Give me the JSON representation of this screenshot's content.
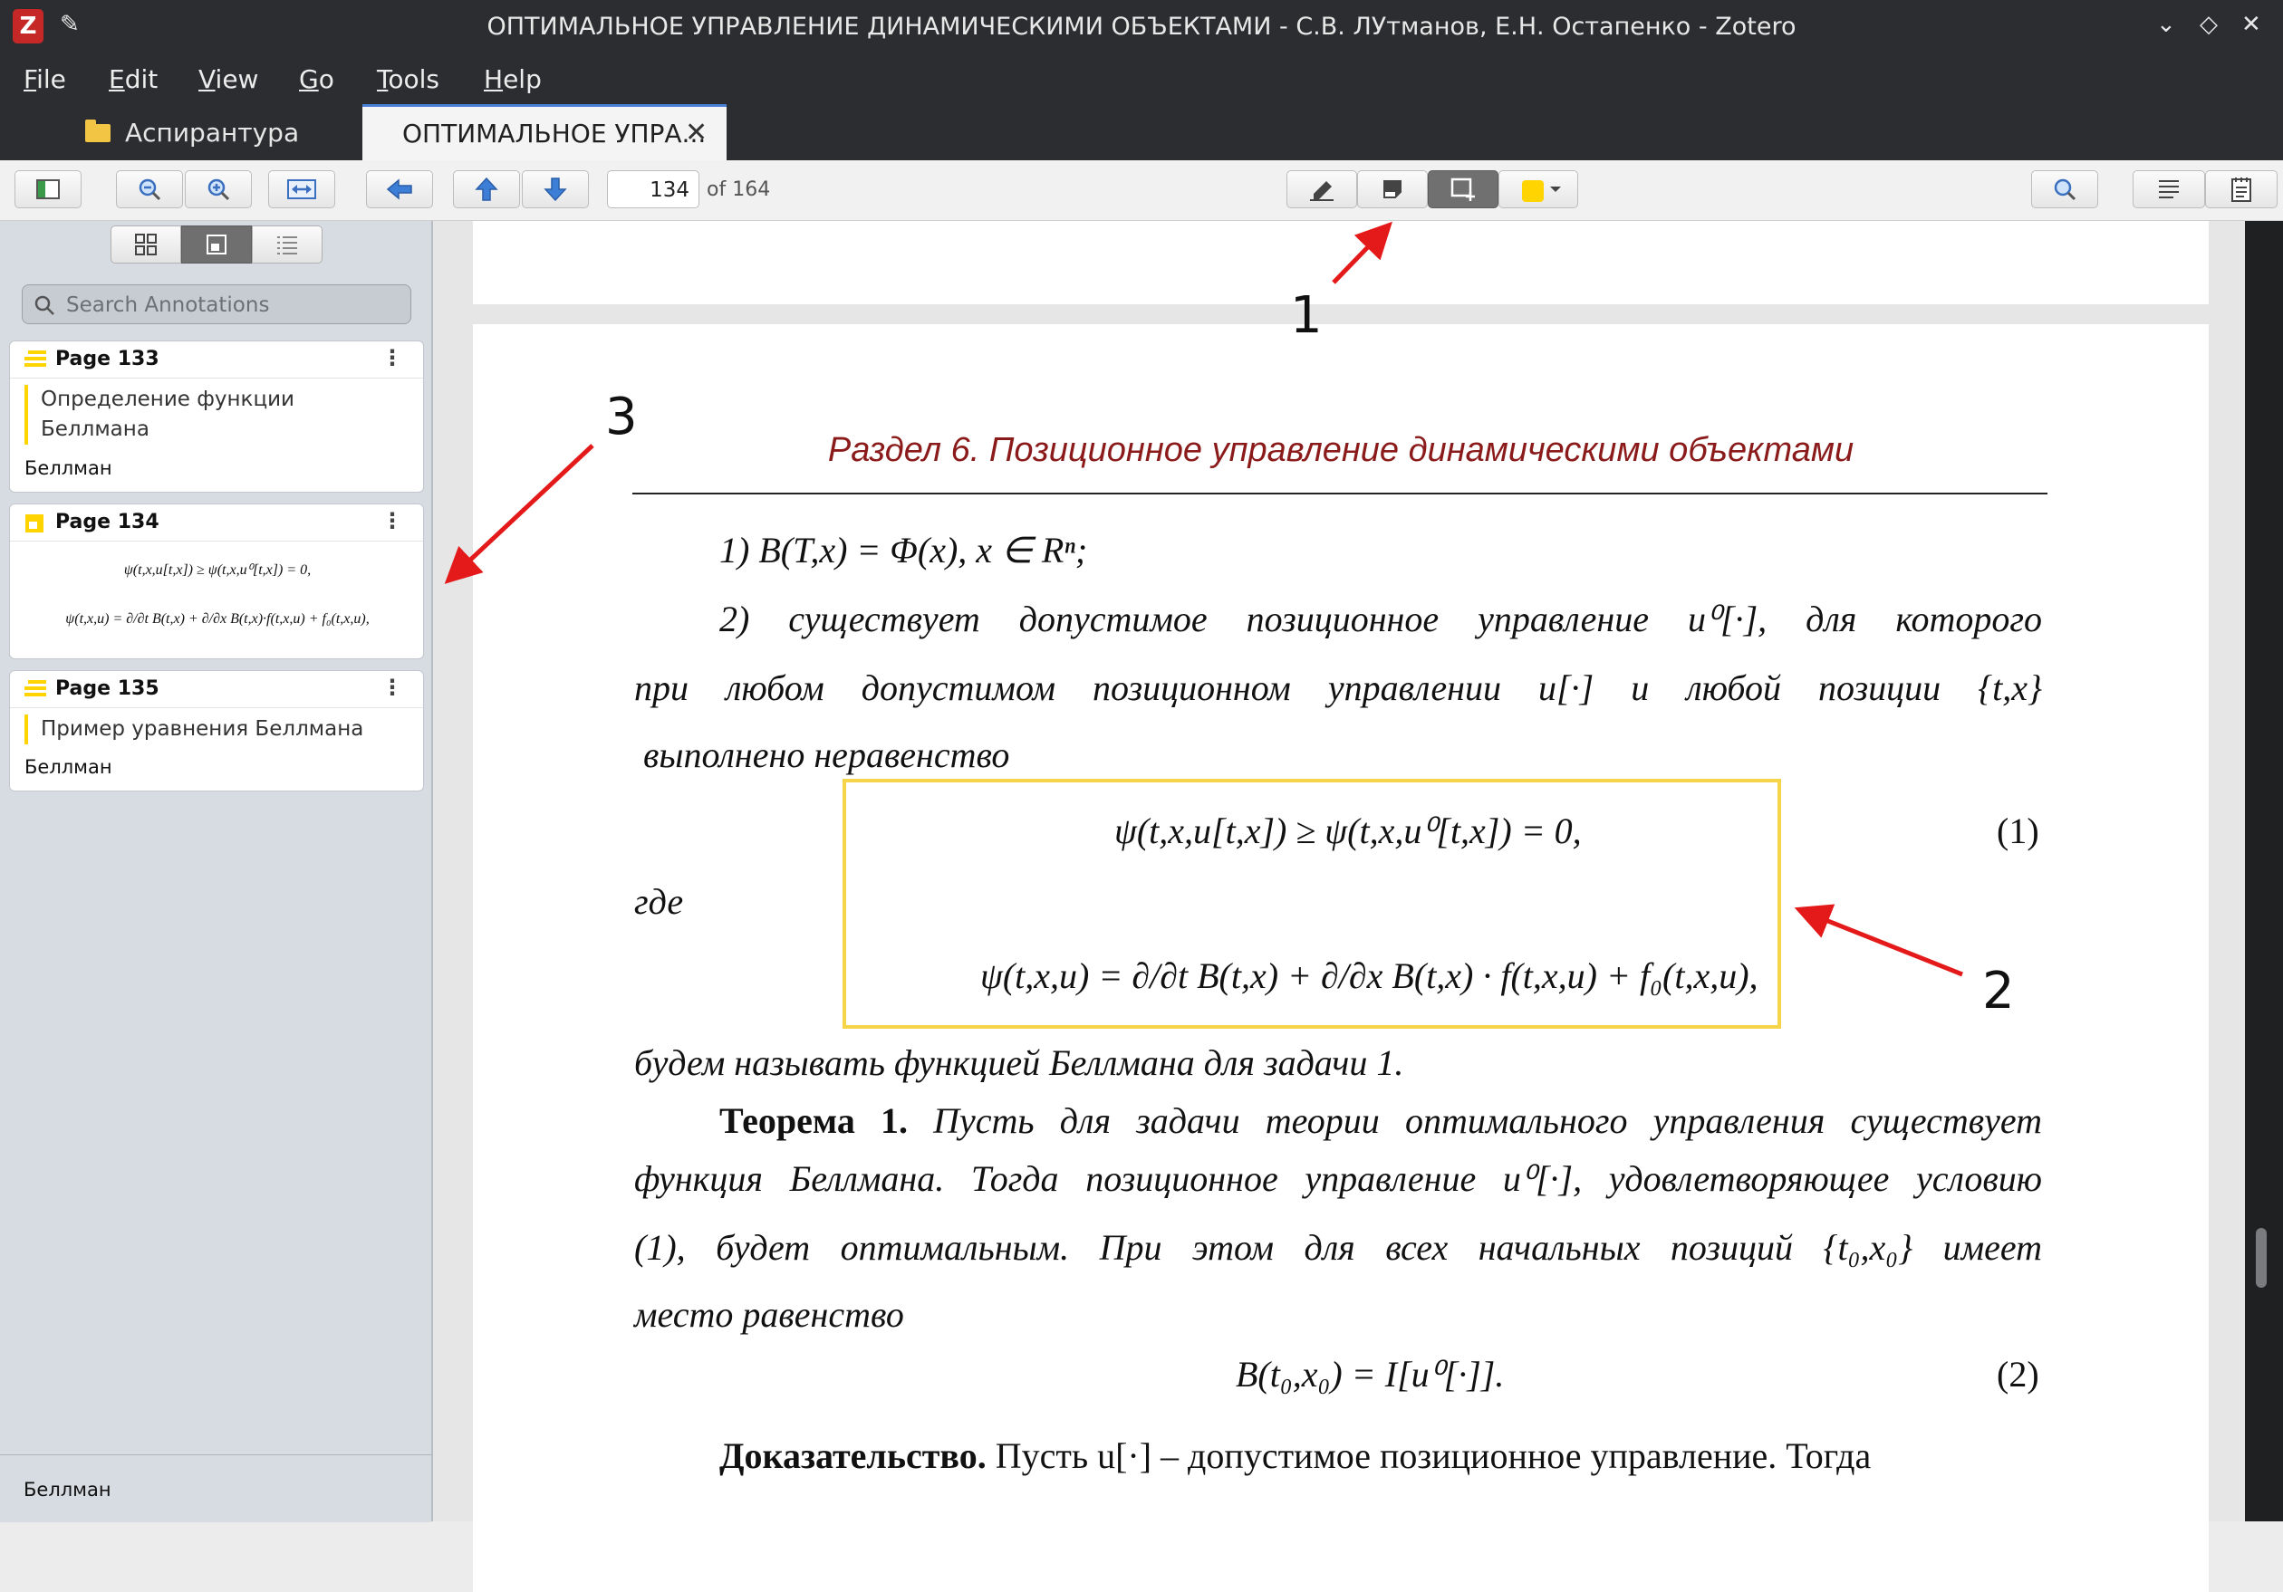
{
  "window": {
    "title": "ОПТИМАЛЬНОЕ УПРАВЛЕНИЕ ДИНАМИЧЕСКИМИ ОБЪЕКТАМИ - С.В. ЛУтманов, Е.Н. Остапенко - Zotero"
  },
  "menu": {
    "file": {
      "u": "F",
      "rest": "ile"
    },
    "edit": {
      "u": "E",
      "rest": "dit"
    },
    "view": {
      "u": "V",
      "rest": "iew"
    },
    "go": {
      "u": "G",
      "rest": "o"
    },
    "tools": {
      "u": "T",
      "rest": "ools"
    },
    "help": {
      "u": "H",
      "rest": "elp"
    }
  },
  "tabs": {
    "library": "Аспирантура",
    "reader": "ОПТИМАЛЬНОЕ УПРА..."
  },
  "toolbar": {
    "page_number": "134",
    "page_of": "of 164",
    "highlight_color": "#ffd400"
  },
  "sidebar": {
    "search_placeholder": "Search Annotations",
    "annotations": [
      {
        "page": "Page 133",
        "text_line1": "Определение функции",
        "text_line2": "Беллмана",
        "tag": "Беллман"
      },
      {
        "page": "Page 134",
        "formula1": "ψ(t,x,u[t,x]) ≥ ψ(t,x,u⁰[t,x]) = 0,",
        "formula2": "ψ(t,x,u) = ∂/∂t B(t,x) + ∂/∂x B(t,x)·f(t,x,u) + f₀(t,x,u),"
      },
      {
        "page": "Page 135",
        "text_line1": "Пример уравнения Беллмана",
        "tag": "Беллман"
      }
    ],
    "footer_tag": "Беллман"
  },
  "document": {
    "section_title": "Раздел 6. Позиционное управление динамическими объектами",
    "line1": "1)   B(T,x) = Φ(x),    x ∈ Rⁿ;",
    "line2": "2) существует допустимое позиционное управление u⁰[·], для которого",
    "line3": "при любом допустимом позиционном управлении u[·] и любой позиции {t,x}",
    "line4": "выполнено неравенство",
    "eq1": "ψ(t,x,u[t,x]) ≥ ψ(t,x,u⁰[t,x]) = 0,",
    "eq1_num": "(1)",
    "where": "где",
    "eq_psi": "ψ(t,x,u) = ∂/∂t B(t,x) + ∂/∂x B(t,x) · f(t,x,u) + f₀(t,x,u),",
    "line5": "будем называть функцией Беллмана для задачи 1.",
    "theorem_label": "Теорема 1.",
    "theorem_line1": " Пусть для задачи теории оптимального управления существует",
    "theorem_line2": "функция Беллмана. Тогда позиционное управление u⁰[·], удовлетворяющее условию",
    "theorem_line3": "(1), будет оптимальным. При этом для всех начальных позиций {t₀,x₀} имеет",
    "theorem_line4": "место равенство",
    "eq2": "B(t₀,x₀) = I[u⁰[·]].",
    "eq2_num": "(2)",
    "proof_label": "Доказательство.",
    "proof_text": " Пусть u[·] – допустимое позиционное управление. Тогда"
  },
  "callouts": {
    "one": "1",
    "two": "2",
    "three": "3"
  },
  "colors": {
    "arrow": "#e41a1a",
    "box": "#f7d54a",
    "title_red": "#8b1a1a"
  }
}
